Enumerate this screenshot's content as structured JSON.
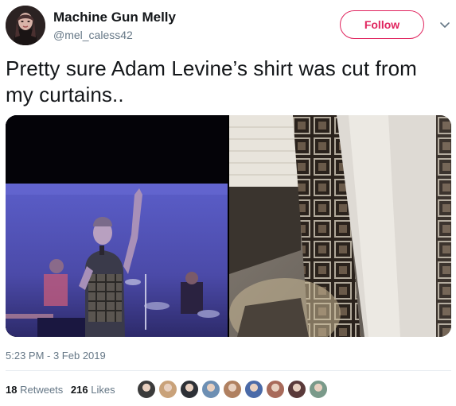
{
  "user": {
    "display_name": "Machine Gun Melly",
    "handle": "@mel_caless42"
  },
  "actions": {
    "follow_label": "Follow"
  },
  "tweet": {
    "text": "Pretty sure Adam Levine’s shirt was cut from my curtains..",
    "timestamp": "5:23 PM - 3 Feb 2019"
  },
  "stats": {
    "retweets_count": "18",
    "retweets_label": "Retweets",
    "likes_count": "216",
    "likes_label": "Likes"
  },
  "likers": [
    {
      "color": "#3b3b3b"
    },
    {
      "color": "#c9a27a"
    },
    {
      "color": "#2d3036"
    },
    {
      "color": "#6d8fb3"
    },
    {
      "color": "#b08060"
    },
    {
      "color": "#4a6aa8"
    },
    {
      "color": "#a86a5a"
    },
    {
      "color": "#5a3a3a"
    },
    {
      "color": "#7a9a8a"
    }
  ],
  "colors": {
    "accent": "#e0245e",
    "secondary_text": "#657786",
    "primary_text": "#14171a",
    "divider": "#e6ecf0"
  },
  "icons": {
    "chevron": "chevron-down-icon"
  }
}
